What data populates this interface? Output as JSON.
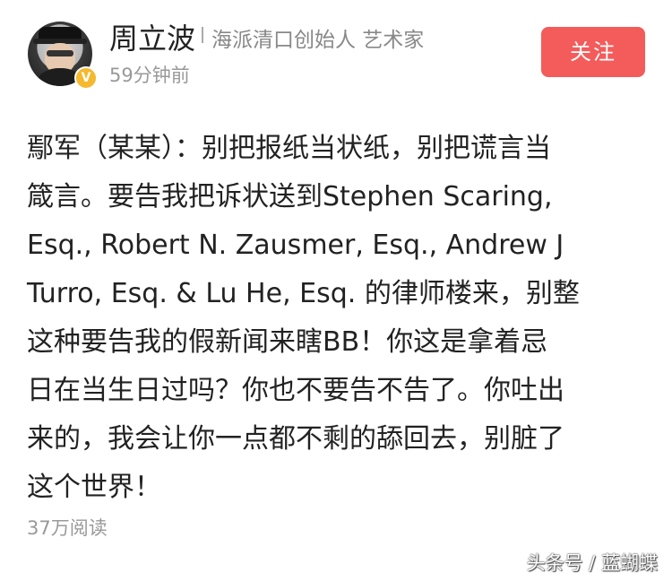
{
  "author": {
    "name": "周立波",
    "title": "海派清口创始人 艺术家",
    "time": "59分钟前",
    "verified_badge": "V",
    "avatar_icon": "user-avatar"
  },
  "follow_button": {
    "label": "关注",
    "color": "#f45b5b"
  },
  "post": {
    "lines": [
      "鄢军（某某）：别把报纸当状纸，别把谎言当",
      "箴言。要告我把诉状送到Stephen Scaring,",
      "Esq., Robert N. Zausmer, Esq., Andrew J",
      "Turro, Esq. & Lu He, Esq. 的律师楼来，别整",
      "这种要告我的假新闻来瞎BB！你这是拿着忌",
      "日在当生日过吗？你也不要告不告了。你吐出",
      "来的，我会让你一点都不剩的舔回去，别脏了",
      "这个世界！"
    ]
  },
  "reads": "37万阅读",
  "watermark": "头条号 / 蓝蝴蝶"
}
